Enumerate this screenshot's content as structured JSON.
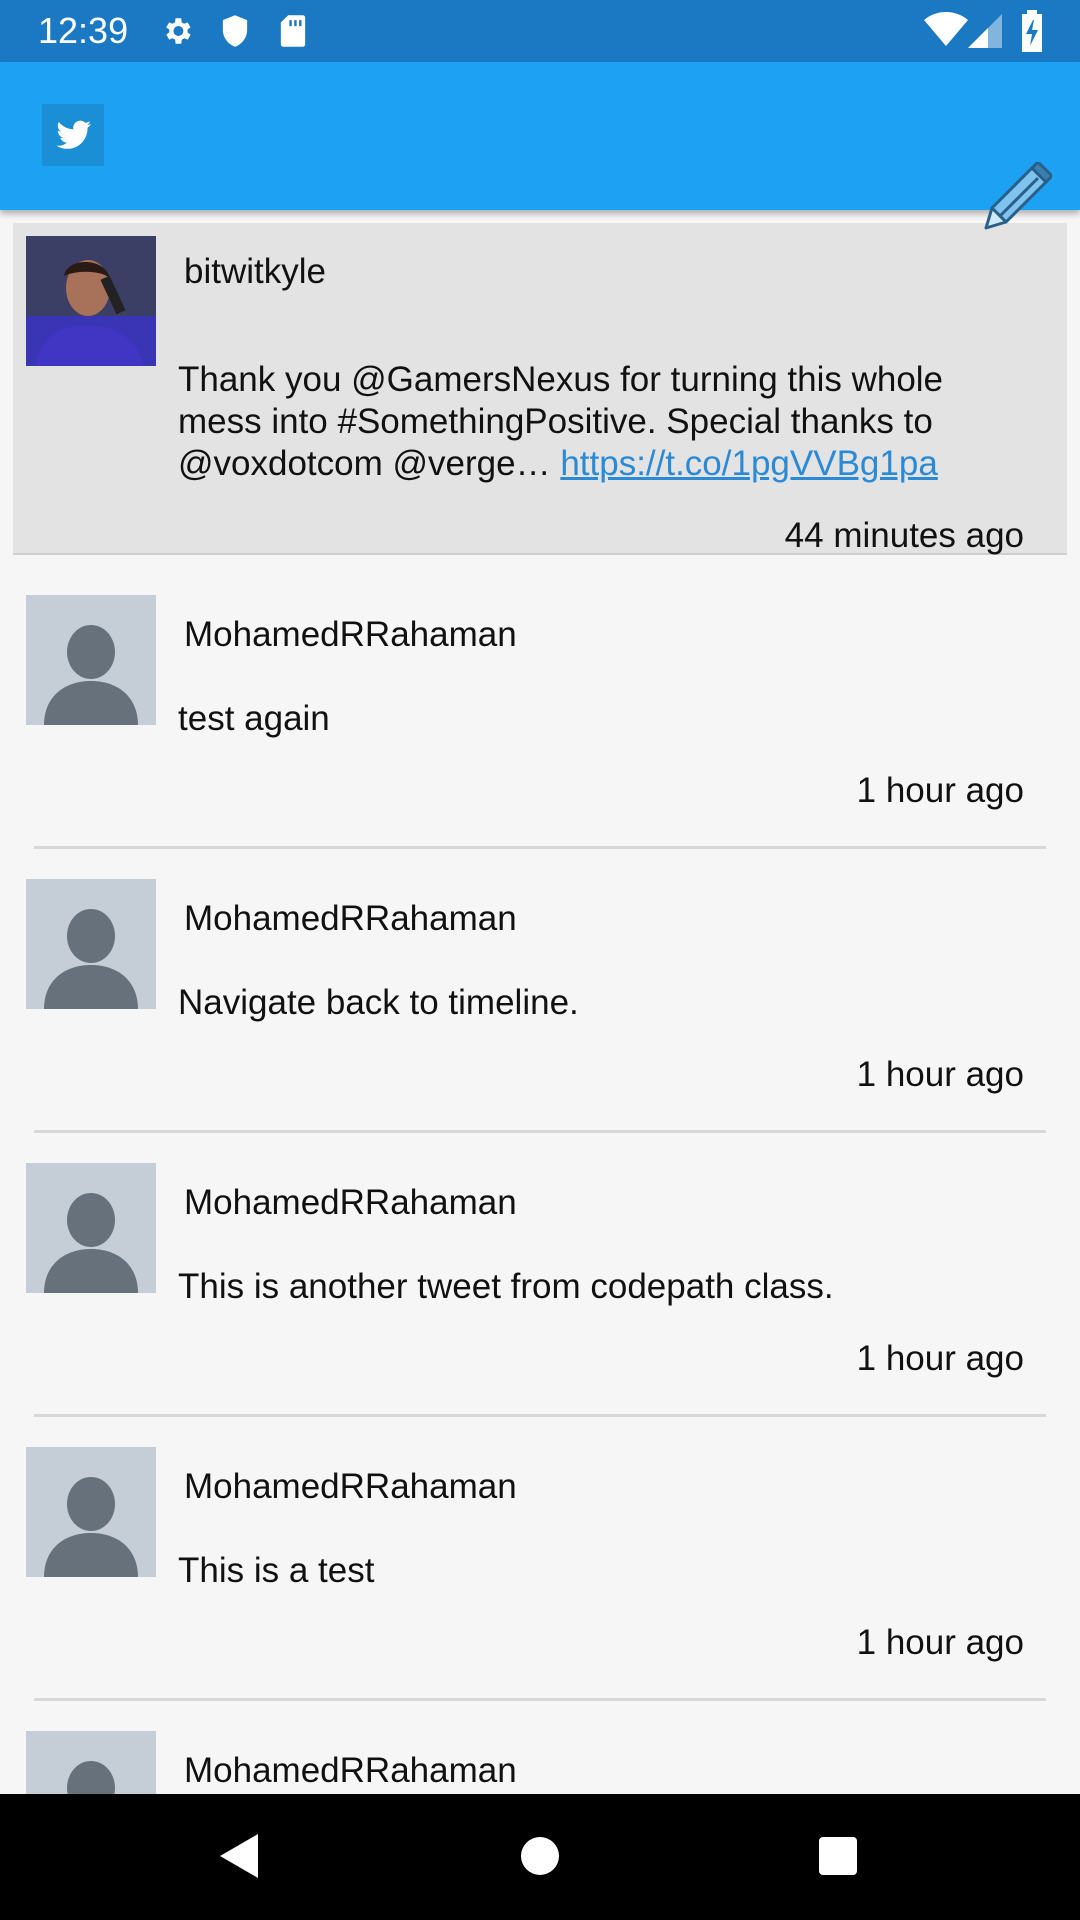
{
  "status_bar": {
    "time": "12:39",
    "left_icons": [
      "gear-icon",
      "shield-icon",
      "sd-card-icon"
    ],
    "right_icons": [
      "wifi-icon",
      "cell-signal-icon",
      "battery-charging-icon"
    ]
  },
  "app_bar": {
    "logo_icon": "twitter-bird-icon",
    "action_icon": "pencil-icon"
  },
  "tweets": [
    {
      "username": "bitwitkyle",
      "text": "Thank you @GamersNexus for turning this whole mess into #SomethingPositive. Special thanks to @voxdotcom @verge… ",
      "link": "https://t.co/1pgVVBg1pa",
      "time": "44 minutes ago"
    },
    {
      "username": "MohamedRRahaman",
      "text": "test again",
      "time": "1 hour ago"
    },
    {
      "username": "MohamedRRahaman",
      "text": "Navigate back to timeline.",
      "time": "1 hour ago"
    },
    {
      "username": "MohamedRRahaman",
      "text": "This is another tweet from codepath class.",
      "time": "1 hour ago"
    },
    {
      "username": "MohamedRRahaman",
      "text": "This is a test",
      "time": "1 hour ago"
    },
    {
      "username": "MohamedRRahaman"
    }
  ],
  "colors": {
    "status_bar": "#1b79c4",
    "app_bar": "#1da1f2",
    "link": "#2a8ad6",
    "highlight": "#e3e3e3"
  }
}
